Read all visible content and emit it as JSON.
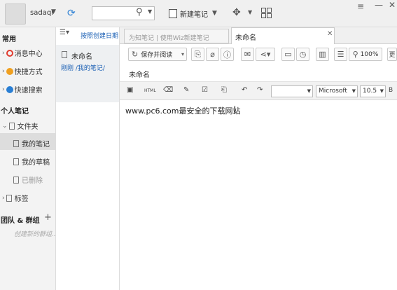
{
  "topbar": {
    "username": "sadaqi",
    "search_placeholder": "",
    "new_note_label": "新建笔记"
  },
  "sidebar": {
    "section_common": "常用",
    "items_common": [
      {
        "label": "消息中心",
        "icon": "message-icon",
        "color": "#e03b2f"
      },
      {
        "label": "快捷方式",
        "icon": "shortcut-icon",
        "color": "#f0a020"
      },
      {
        "label": "快速搜索",
        "icon": "quick-search-icon",
        "color": "#2a7fd4"
      }
    ],
    "section_personal": "个人笔记",
    "folder_label": "文件夹",
    "subfolders": [
      {
        "label": "我的笔记",
        "selected": true
      },
      {
        "label": "我的草稿",
        "selected": false
      },
      {
        "label": "已删除",
        "selected": false
      }
    ],
    "tags_label": "标签",
    "section_groups": "团队 & 群组",
    "create_group_hint": "创建新的群组..."
  },
  "notelist": {
    "sort_label": "按照创建日期",
    "notes": [
      {
        "title": "未命名",
        "meta": "刚刚  /我的笔记/"
      }
    ]
  },
  "tabs": [
    {
      "label": "为知笔记 | 使用Wiz新建笔记",
      "active": false
    },
    {
      "label": "未命名",
      "active": true
    }
  ],
  "toolbar": {
    "save_label": "保存并阅读",
    "zoom": "100%",
    "more": "更"
  },
  "editor": {
    "title": "未命名",
    "font_name": "Microsoft",
    "font_size": "10.5",
    "paragraph_style": "",
    "html_label": "HTML",
    "content": "www.pc6.com最安全的下载网站"
  }
}
